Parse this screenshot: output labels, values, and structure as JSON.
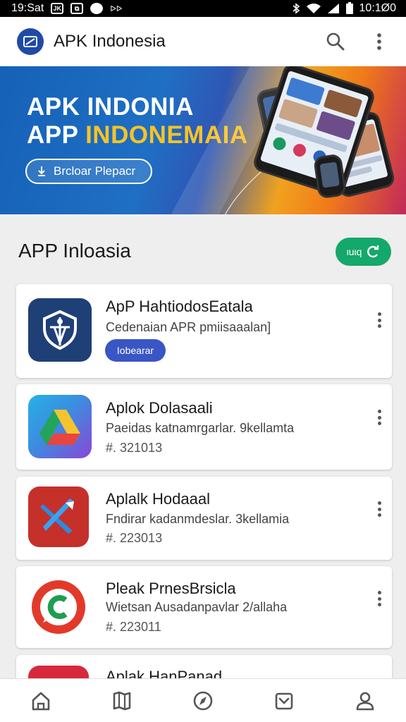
{
  "status_bar": {
    "time": "19:Sat",
    "indicator_a": "JK",
    "indicator_b": "⧉",
    "indicator_c": "ᐅᐅ",
    "clock": "10:1Ø0"
  },
  "app_bar": {
    "title": "APK Indonesia",
    "icons": [
      "app-logo-icon",
      "search-icon",
      "more-vert-icon"
    ]
  },
  "banner": {
    "title_line1": "APK INDONIA",
    "title_line2_prefix": "APP ",
    "title_line2_highlight": "INDONEMAIA",
    "button_label": "Brcloar  Plepacr",
    "colors": {
      "blue": "#1561b8",
      "orange": "#f0a21e",
      "magenta": "#c2285a",
      "highlight": "#f7c325"
    }
  },
  "section": {
    "title": "APP Inloasia",
    "refresh_label": "ιuιq",
    "refresh_color": "#14a86c"
  },
  "apps": [
    {
      "name": "ApP HahtiodosEatala",
      "desc": "Cedenaian APR pmiisaaalan]",
      "chip": "Iobearar",
      "icon": "shield-icon",
      "icon_bg": "#1f3f77"
    },
    {
      "name": "Aplok Dolasaali",
      "desc": "Paeidas katnamrgarlar. 9kellamta",
      "meta": "#. 321013",
      "icon": "drive-triangle-icon",
      "icon_bg": "#3b8de0"
    },
    {
      "name": "Aplalk Hodaaal",
      "desc": "Fndirar kadanmdeslar. 3kellamia",
      "meta": "#. 223013",
      "icon": "cross-arrow-icon",
      "icon_bg": "#c5302b"
    },
    {
      "name": "Pleak PrnesBrsicla",
      "desc": "Wietsan Ausadanpavlar 2/allaha",
      "meta": "#. 223011",
      "icon": "chat-c-icon",
      "icon_bg": "#e23a2a"
    },
    {
      "name": "Aplak HanPanad",
      "icon": "app-icon",
      "icon_bg": "#d8283d"
    }
  ],
  "bottom_nav": [
    "home-icon",
    "map-icon",
    "compass-icon",
    "download-box-icon",
    "profile-icon"
  ]
}
